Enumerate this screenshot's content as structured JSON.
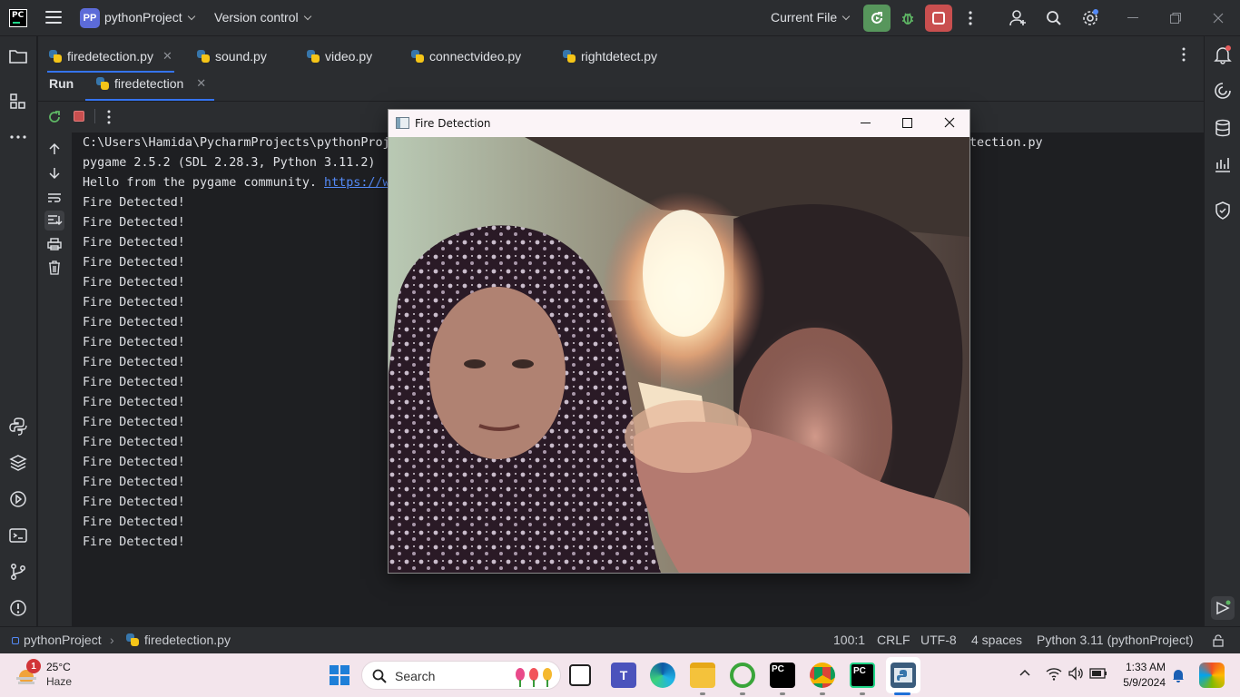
{
  "titlebar": {
    "project_badge": "PP",
    "project_name": "pythonProject",
    "version_control": "Version control",
    "run_config": "Current File"
  },
  "editor_tabs": [
    {
      "label": "firedetection.py",
      "active": true
    },
    {
      "label": "sound.py"
    },
    {
      "label": "video.py"
    },
    {
      "label": "connectvideo.py"
    },
    {
      "label": "rightdetect.py"
    }
  ],
  "run_panel": {
    "title": "Run",
    "tab_label": "firedetection"
  },
  "console": {
    "path_line_start": "C:\\Users\\Hamida\\PycharmProjects\\pythonProj",
    "path_line_end": "tection.py",
    "pygame_line": "pygame 2.5.2 (SDL 2.28.3, Python 3.11.2)",
    "hello_text": "Hello from the pygame community. ",
    "hello_link": "https://w",
    "fire_lines": [
      "Fire Detected!",
      "Fire Detected!",
      "Fire Detected!",
      "Fire Detected!",
      "Fire Detected!",
      "Fire Detected!",
      "Fire Detected!",
      "Fire Detected!",
      "Fire Detected!",
      "Fire Detected!",
      "Fire Detected!",
      "Fire Detected!",
      "Fire Detected!",
      "Fire Detected!",
      "Fire Detected!",
      "Fire Detected!",
      "Fire Detected!",
      "Fire Detected!"
    ]
  },
  "fire_window": {
    "title": "Fire Detection"
  },
  "statusbar": {
    "breadcrumb_project": "pythonProject",
    "breadcrumb_file": "firedetection.py",
    "position": "100:1",
    "line_sep": "CRLF",
    "encoding": "UTF-8",
    "indent": "4 spaces",
    "interpreter": "Python 3.11 (pythonProject)"
  },
  "taskbar": {
    "weather_temp": "25°C",
    "weather_desc": "Haze",
    "weather_badge": "1",
    "search_placeholder": "Search",
    "time": "1:33 AM",
    "date": "5/9/2024"
  },
  "colors": {
    "ide_bg": "#1e1f22",
    "panel_bg": "#2b2d30",
    "accent_green": "#57965c",
    "stop_red": "#c94f4f",
    "link_blue": "#548af7"
  }
}
